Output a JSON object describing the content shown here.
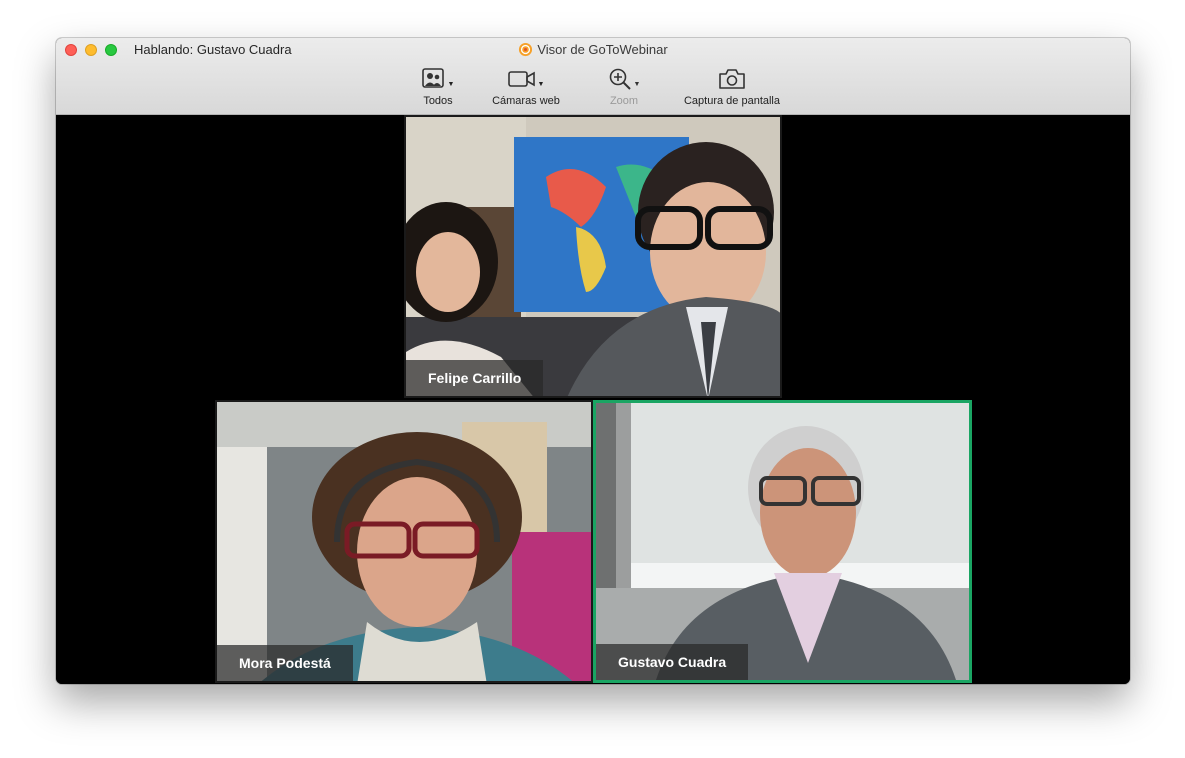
{
  "window": {
    "speaking_label": "Hablando: Gustavo Cuadra",
    "title": "Visor de GoToWebinar"
  },
  "toolbar": {
    "items": [
      {
        "label": "Todos",
        "icon": "people-grid-icon",
        "has_dropdown": true,
        "enabled": true
      },
      {
        "label": "Cámaras web",
        "icon": "webcam-icon",
        "has_dropdown": true,
        "enabled": true
      },
      {
        "label": "Zoom",
        "icon": "zoom-in-icon",
        "has_dropdown": true,
        "enabled": false
      },
      {
        "label": "Captura de pantalla",
        "icon": "camera-icon",
        "has_dropdown": false,
        "enabled": true
      }
    ]
  },
  "participants": [
    {
      "name": "Felipe Carrillo",
      "active_speaker": false
    },
    {
      "name": "Mora Podestá",
      "active_speaker": false
    },
    {
      "name": "Gustavo Cuadra",
      "active_speaker": true
    }
  ],
  "colors": {
    "active_speaker_border": "#1aa563",
    "badge_background": "#282828",
    "close": "#fe5f57",
    "minimize": "#febc2e",
    "maximize": "#28c840"
  }
}
